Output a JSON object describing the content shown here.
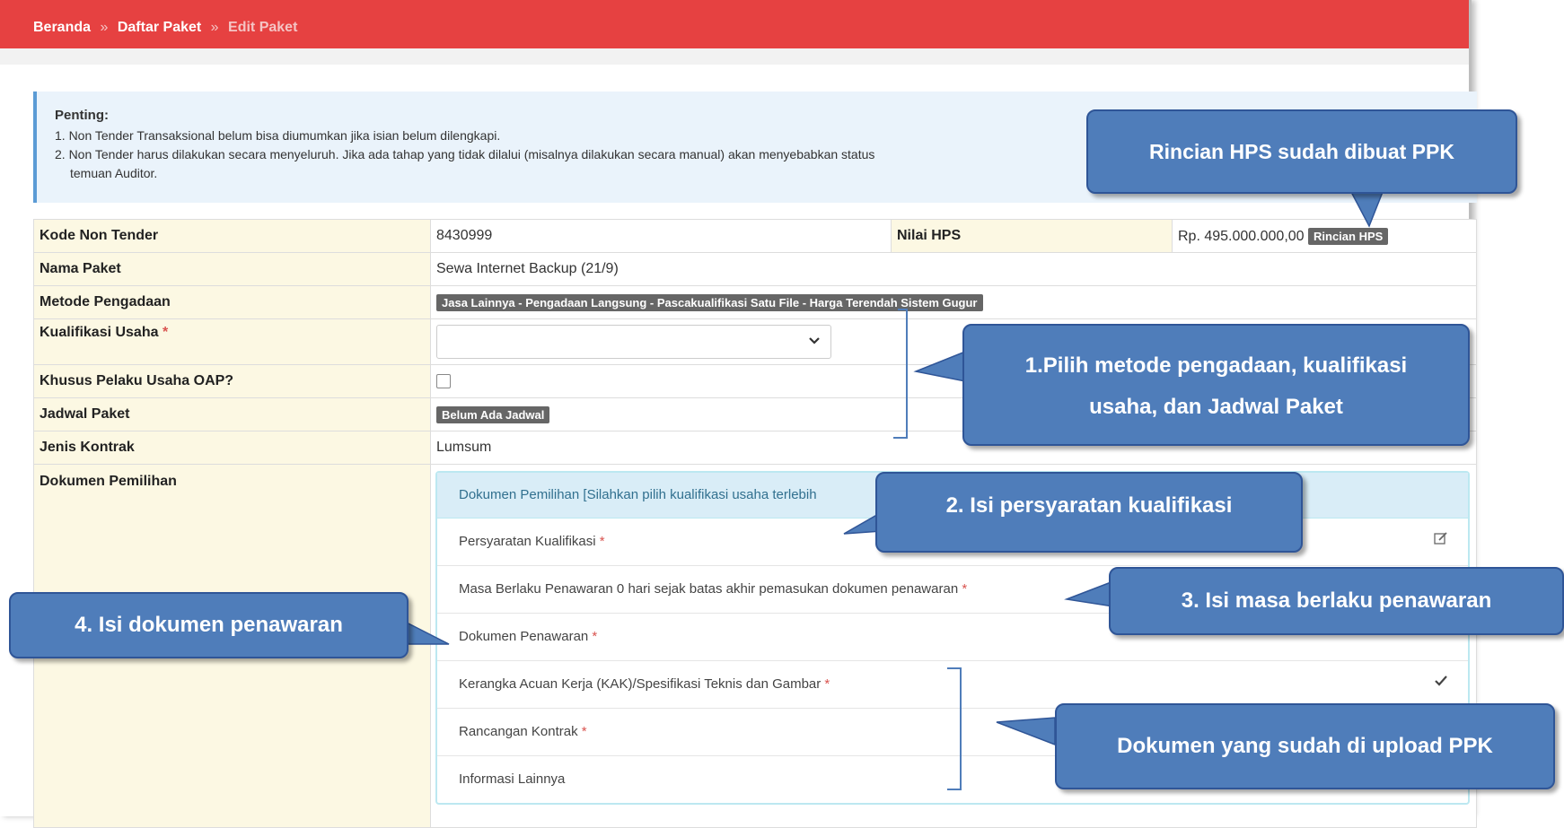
{
  "breadcrumb": {
    "home": "Beranda",
    "separator": "»",
    "list": "Daftar Paket",
    "current": "Edit Paket"
  },
  "alert": {
    "title": "Penting:",
    "item1": "1. Non Tender Transaksional belum bisa diumumkan jika isian belum dilengkapi.",
    "item2": "2. Non Tender harus dilakukan secara menyeluruh. Jika ada tahap yang tidak dilalui (misalnya dilakukan secara manual) akan menyebabkan status",
    "item2_cont": "temuan Auditor."
  },
  "form": {
    "kode_label": "Kode Non Tender",
    "kode_value": "8430999",
    "hps_label": "Nilai HPS",
    "hps_value": "Rp. 495.000.000,00",
    "rincian_hps_button": "Rincian HPS",
    "nama_label": "Nama Paket",
    "nama_value": "Sewa Internet Backup (21/9)",
    "metode_label": "Metode Pengadaan",
    "metode_value": "Jasa Lainnya - Pengadaan Langsung - Pascakualifikasi Satu File - Harga Terendah Sistem Gugur",
    "kualifikasi_label": "Kualifikasi Usaha",
    "required_mark": "*",
    "kualifikasi_value": "",
    "oap_label": "Khusus Pelaku Usaha OAP?",
    "jadwal_label": "Jadwal Paket",
    "jadwal_value": "Belum Ada Jadwal",
    "kontrak_label": "Jenis Kontrak",
    "kontrak_value": "Lumsum",
    "dokumen_label": "Dokumen Pemilihan"
  },
  "panel": {
    "header": "Dokumen Pemilihan [Silahkan pilih kualifikasi usaha terlebih",
    "rows": [
      {
        "label": "Persyaratan Kualifikasi",
        "icon": "edit-icon"
      },
      {
        "label": "Masa Berlaku Penawaran 0 hari sejak batas akhir pemasukan dokumen penawaran",
        "icon": "edit-icon"
      },
      {
        "label": "Dokumen Penawaran",
        "icon": "edit-icon"
      },
      {
        "label": "Kerangka Acuan Kerja (KAK)/Spesifikasi Teknis dan Gambar",
        "icon": "check-icon"
      },
      {
        "label": "Rancangan Kontrak",
        "icon": ""
      },
      {
        "label": "Informasi Lainnya",
        "icon": ""
      }
    ]
  },
  "callouts": {
    "hps": "Rincian HPS sudah dibuat PPK",
    "step1_line1": "1.Pilih metode pengadaan, kualifikasi",
    "step1_line2": "usaha, dan Jadwal Paket",
    "step2": "2.   Isi  persyaratan kualifikasi",
    "step3": "3.   Isi  masa berlaku penawaran",
    "step4": "4.   Isi  dokumen penawaran",
    "uploaded": "Dokumen yang sudah di upload PPK"
  },
  "colors": {
    "topbar": "#e64141",
    "callout": "#4f7dba",
    "label_bg": "#fcf8e3",
    "panel_head": "#d9edf7"
  }
}
